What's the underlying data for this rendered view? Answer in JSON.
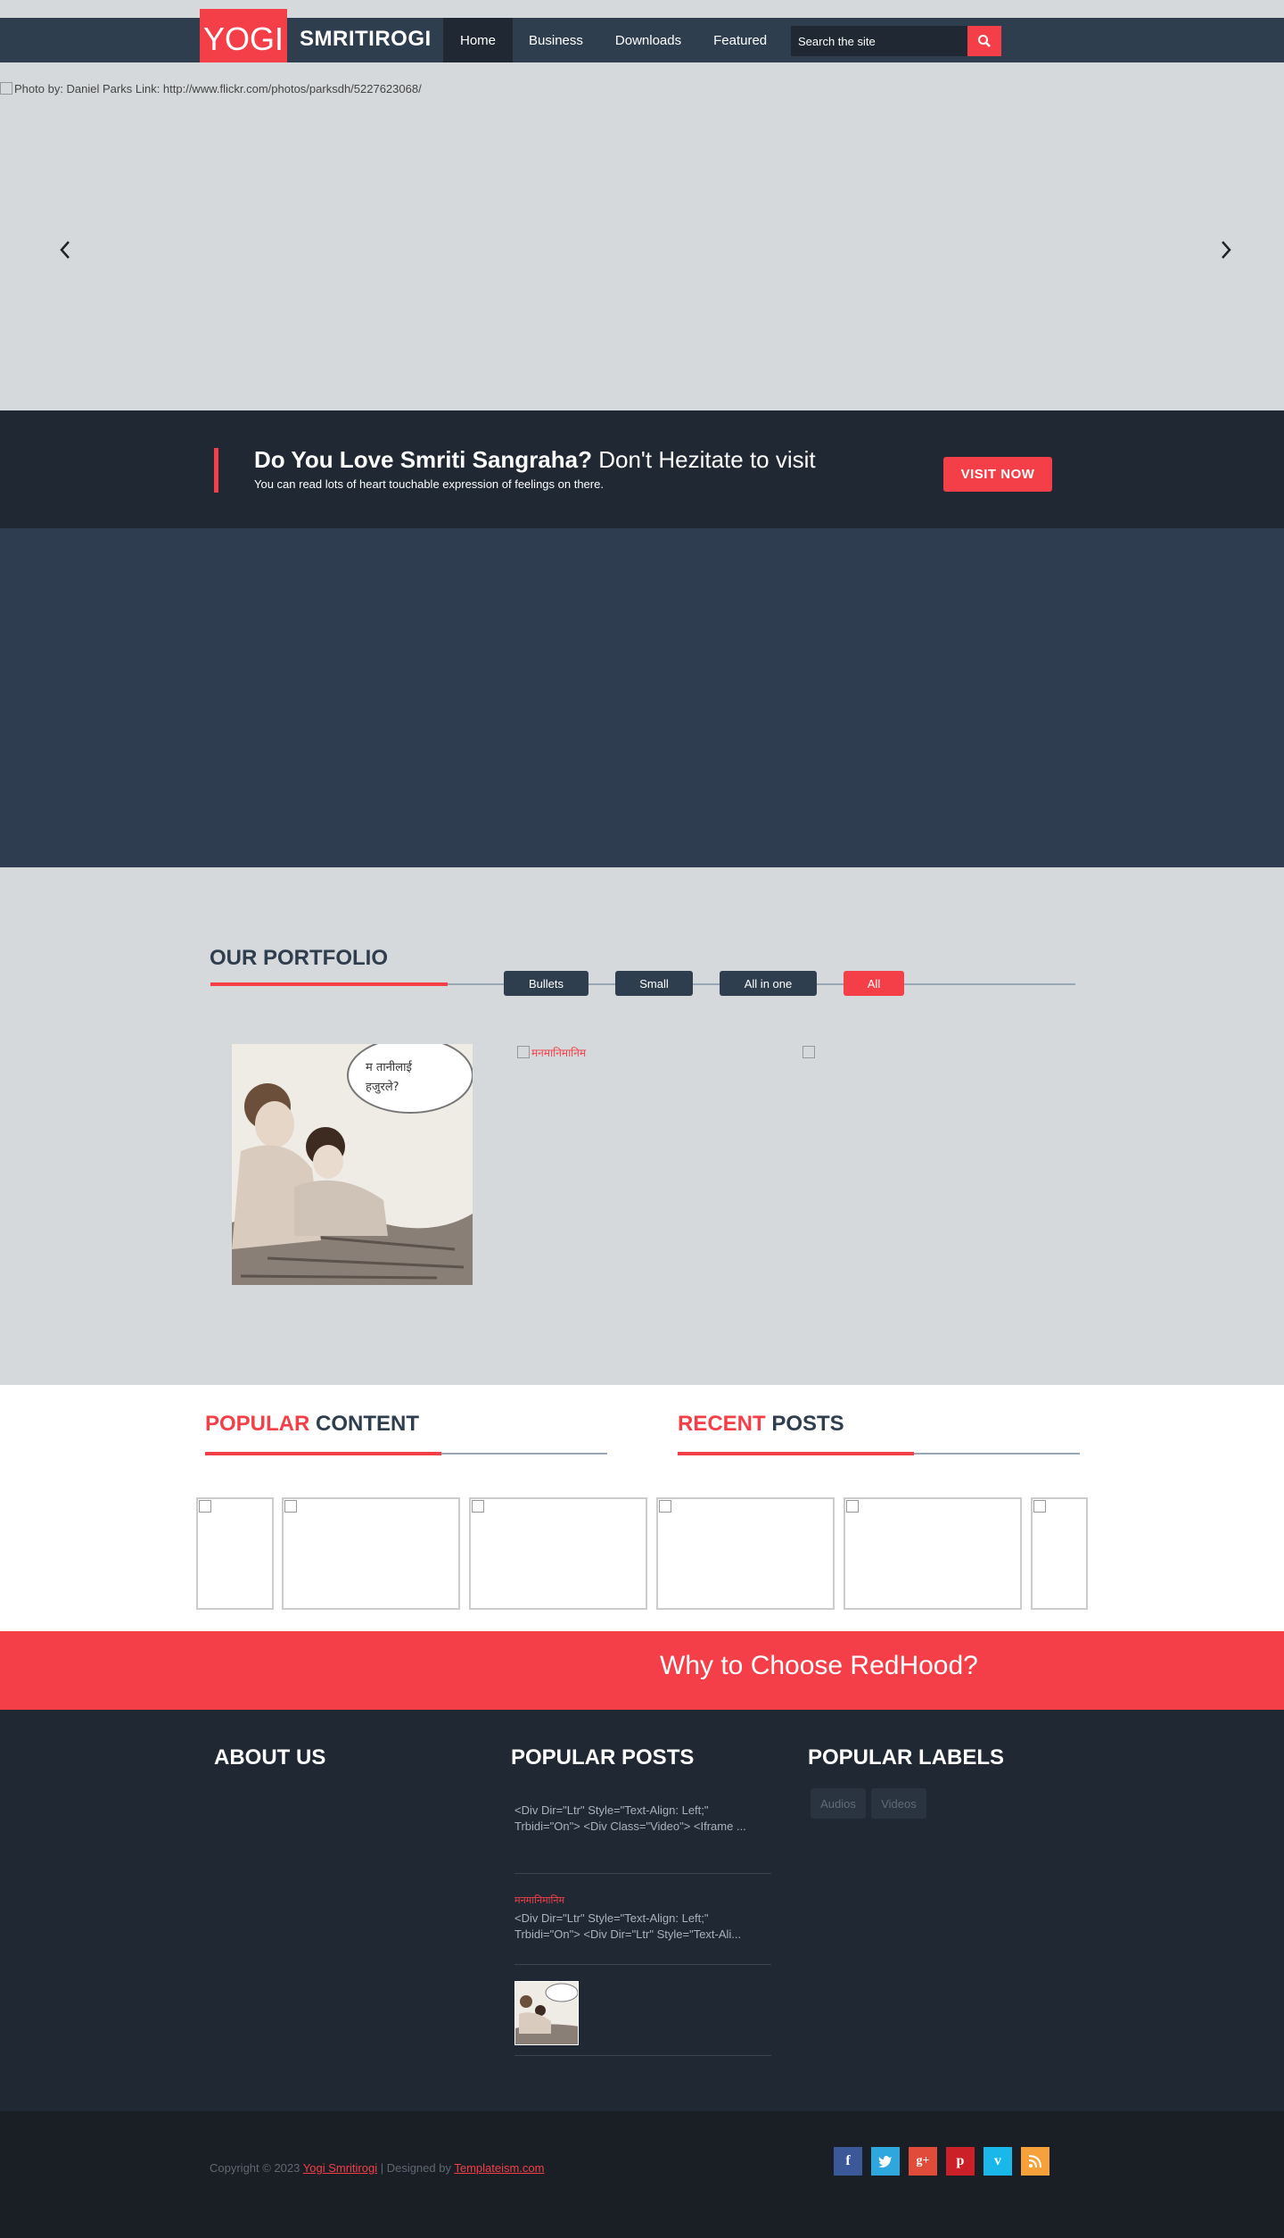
{
  "header": {
    "logo_box": "YOGI",
    "logo_text": "SMRITIROGI",
    "nav": [
      "Home",
      "Business",
      "Downloads",
      "Featured"
    ],
    "search_placeholder": "Search the site",
    "brand_color": "#f43f48"
  },
  "slider": {
    "caption": "Photo by: Daniel Parks Link: http://www.flickr.com/photos/parksdh/5227623068/"
  },
  "callout": {
    "title_bold": "Do You Love Smriti Sangraha?",
    "title_light": "Don't Hezitate to visit",
    "subtitle": "You can read lots of heart touchable expression of feelings on there.",
    "button": "VISIT NOW"
  },
  "portfolio": {
    "title": "OUR PORTFOLIO",
    "filters": [
      "Bullets",
      "Small",
      "All in one",
      "All"
    ],
    "active_filter": "All",
    "item_link": "मनमानिमानिम"
  },
  "popular": {
    "title_red": "POPULAR",
    "title_rest": " CONTENT"
  },
  "recent": {
    "title_red": "RECENT",
    "title_rest": " POSTS"
  },
  "red_band": {
    "title": "Why to Choose RedHood?"
  },
  "footer": {
    "about_title": "ABOUT US",
    "popular_posts_title": "POPULAR POSTS",
    "popular_labels_title": "POPULAR LABELS",
    "posts": [
      {
        "link": "",
        "text": "<Div Dir=\"Ltr\" Style=\"Text-Align: Left;\" Trbidi=\"On\"> <Div Class=\"Video\"> <Iframe ..."
      },
      {
        "link": "मनमानिमानिम",
        "text": "<Div Dir=\"Ltr\" Style=\"Text-Align: Left;\" Trbidi=\"On\"> <Div Dir=\"Ltr\" Style=\"Text-Ali..."
      }
    ],
    "labels": [
      "Audios",
      "Videos"
    ]
  },
  "bottom": {
    "copyright_prefix": "Copyright © 2023 ",
    "site_link": "Yogi Smritirogi",
    "designed_by": " | Designed by ",
    "designer_link": "Templateism.com",
    "social": [
      "facebook",
      "twitter",
      "google-plus",
      "pinterest",
      "vimeo",
      "rss"
    ],
    "social_colors": [
      "#3b5998",
      "#2ea6de",
      "#e04c39",
      "#cb2027",
      "#1ab7ea",
      "#f7a13a"
    ]
  }
}
